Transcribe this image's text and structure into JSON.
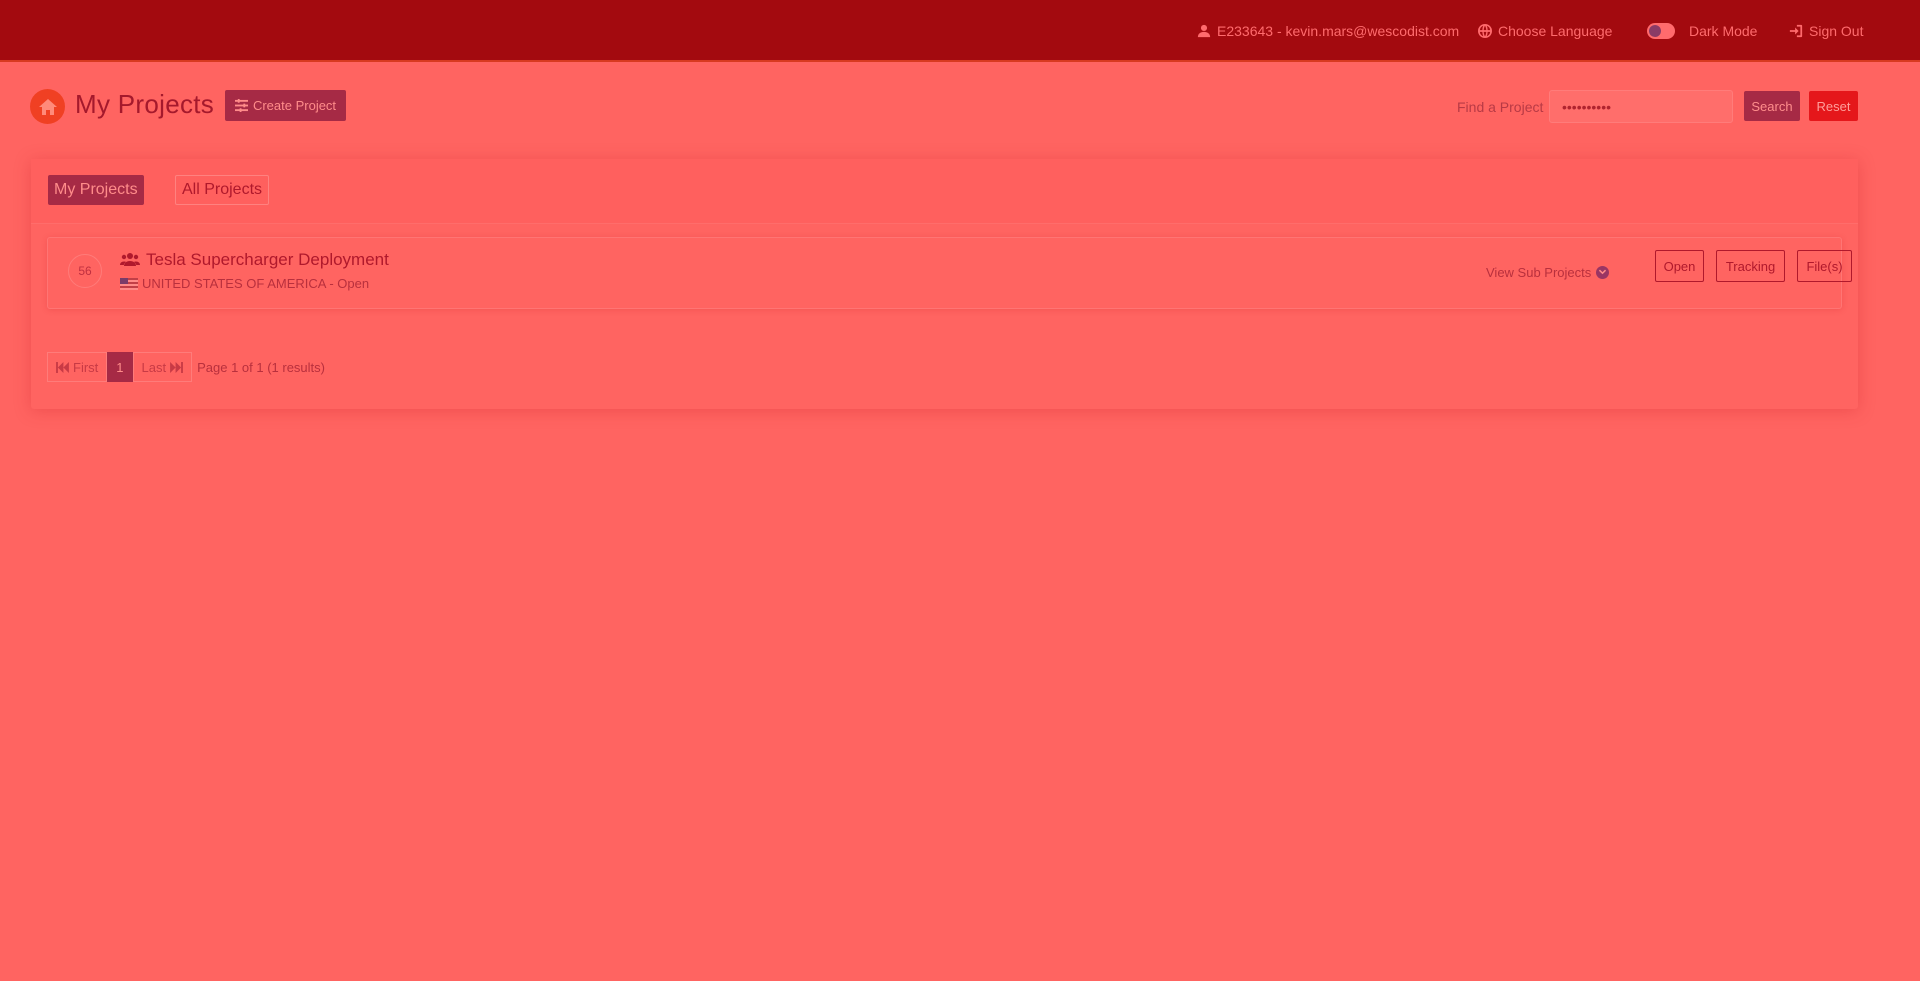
{
  "topnav": {
    "user": "E233643 - kevin.mars@wescodist.com",
    "language": "Choose Language",
    "dark_mode": "Dark Mode",
    "sign_out": "Sign Out"
  },
  "header": {
    "title": "My Projects",
    "create_button": "Create Project",
    "find_label": "Find a Project",
    "search_value": "••••••••••",
    "search_button": "Search",
    "reset_button": "Reset"
  },
  "tabs": [
    {
      "label": "My Projects",
      "active": true
    },
    {
      "label": "All Projects",
      "active": false
    }
  ],
  "projects": [
    {
      "number": "56",
      "title": "Tesla Supercharger Deployment",
      "country": "UNITED STATES OF AMERICA",
      "status": "Open",
      "subtitle": "UNITED STATES OF AMERICA - Open",
      "view_sub": "View Sub Projects",
      "actions": [
        "Open",
        "Tracking",
        "File(s)"
      ]
    }
  ],
  "pagination": {
    "first": "First",
    "current": "1",
    "last": "Last",
    "info": "Page 1 of 1  (1 results)"
  },
  "colors": {
    "background": "#ff6461",
    "topbar": "#a30a0f",
    "accent": "#a62a45",
    "reset": "#e5171b",
    "home": "#f04023"
  }
}
